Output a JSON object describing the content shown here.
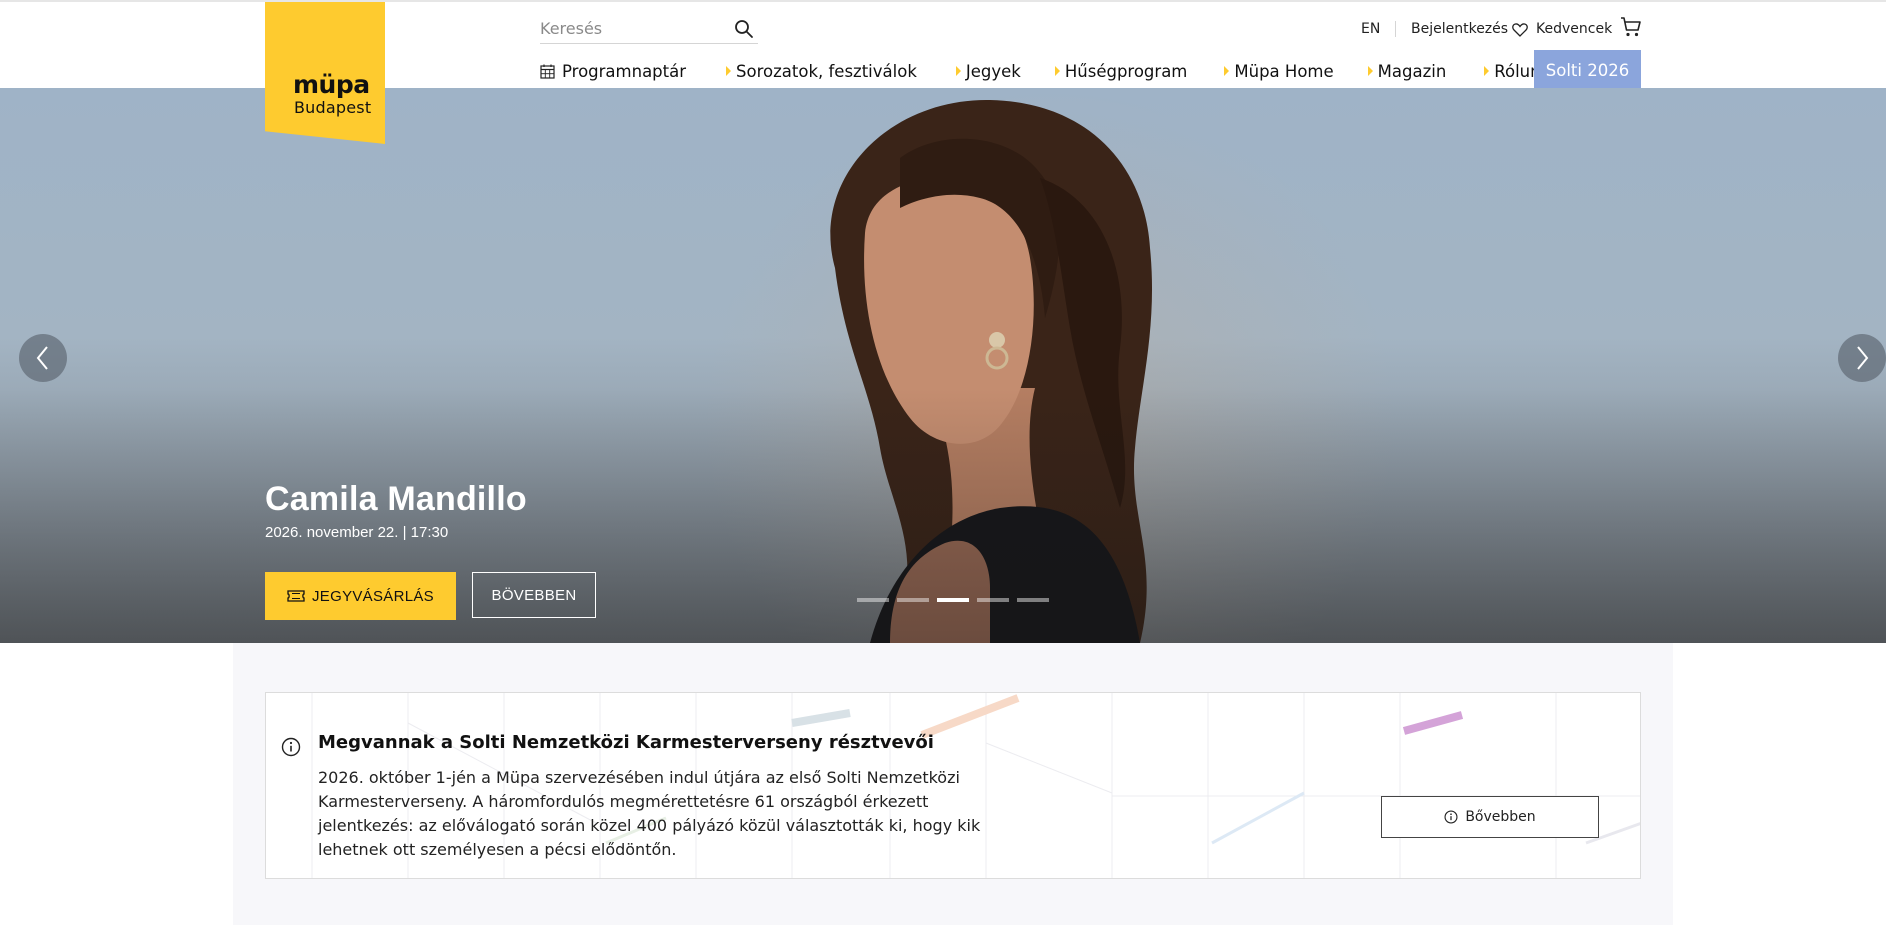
{
  "brand": {
    "name": "müpa",
    "city": "Budapest",
    "color": "#fecb2f"
  },
  "search": {
    "placeholder": "Keresés",
    "icon": "search-icon"
  },
  "utility": {
    "lang": "EN",
    "login": "Bejelentkezés",
    "favorites": "Kedvencek",
    "cart_icon": "cart-icon"
  },
  "nav": {
    "calendar": "Programnaptár",
    "series": "Sorozatok, fesztiválok",
    "tickets": "Jegyek",
    "loyalty": "Hűségprogram",
    "home": "Müpa Home",
    "magazine": "Magazin",
    "about": "Rólunk",
    "highlight": "Solti 2026",
    "highlight_color": "#8ba5dc"
  },
  "hero": {
    "title": "Camila Mandillo",
    "date": "2026. november 22. | 17:30",
    "buy_label": "JEGYVÁSÁRLÁS",
    "more_label": "BÖVEBBEN",
    "slide_count": 5,
    "active_slide": 3
  },
  "notice": {
    "title": "Megvannak a Solti Nemzetközi Karmesterverseny résztvevői",
    "body": "2026. október 1-jén a Müpa szervezésében indul útjára az első Solti Nemzetközi Karmesterverseny. A háromfordulós megmérettetésre 61 országból érkezett jelentkezés: az előválogató során közel 400 pályázó közül választották ki, hogy kik lehetnek ott személyesen a pécsi elődöntőn.",
    "button": "Bővebben"
  }
}
